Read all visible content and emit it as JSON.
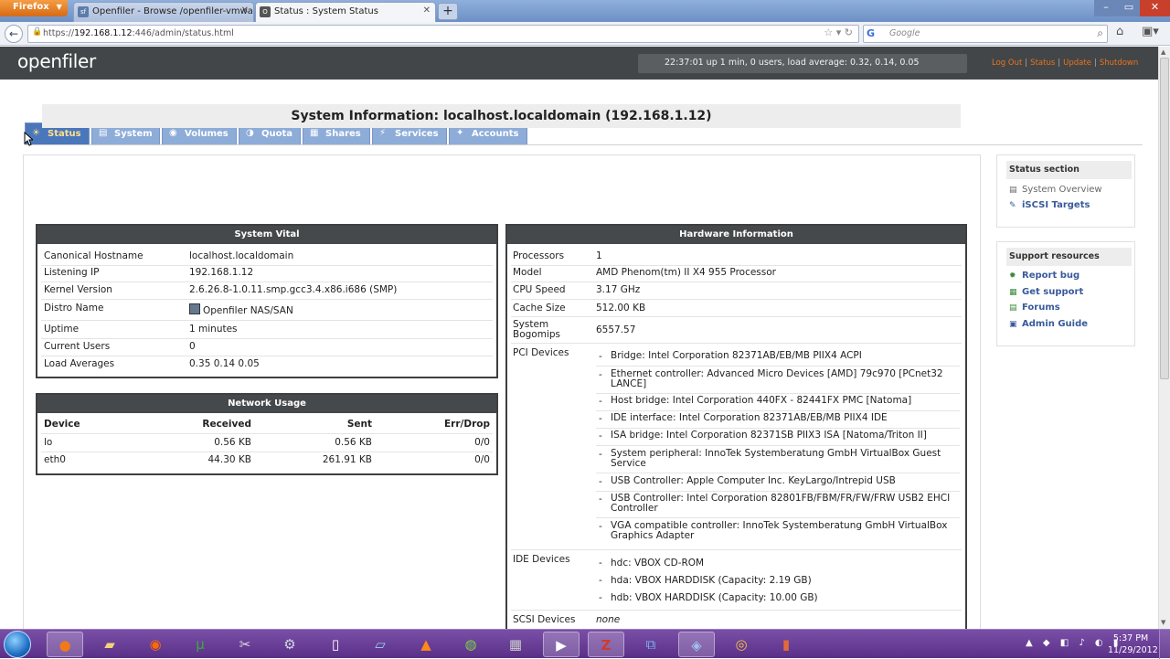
{
  "browser": {
    "app_button": "Firefox",
    "tabs": [
      {
        "title": "Openfiler - Browse /openfiler-vmwar...",
        "icon": "sf"
      },
      {
        "title": "Status : System Status",
        "icon": "O"
      }
    ],
    "url_prefix": "https://",
    "url_host": "192.168.1.12",
    "url_path": ":446/admin/status.html",
    "search_engine": "G",
    "search_placeholder": "Google"
  },
  "header": {
    "logo": "openfiler",
    "uptime": "22:37:01 up 1 min, 0 users, load average: 0.32, 0.14, 0.05",
    "links": [
      "Log Out",
      "Status",
      "Update",
      "Shutdown"
    ]
  },
  "nav_tabs": [
    {
      "label": "Status",
      "icon": "☀"
    },
    {
      "label": "System",
      "icon": "▤"
    },
    {
      "label": "Volumes",
      "icon": "◉"
    },
    {
      "label": "Quota",
      "icon": "◑"
    },
    {
      "label": "Shares",
      "icon": "▦"
    },
    {
      "label": "Services",
      "icon": "⚡"
    },
    {
      "label": "Accounts",
      "icon": "✦"
    }
  ],
  "page_title": "System Information: localhost.localdomain (192.168.1.12)",
  "system_vital": {
    "title": "System Vital",
    "rows": [
      {
        "k": "Canonical Hostname",
        "v": "localhost.localdomain"
      },
      {
        "k": "Listening IP",
        "v": "192.168.1.12"
      },
      {
        "k": "Kernel Version",
        "v": "2.6.26.8-1.0.11.smp.gcc3.4.x86.i686 (SMP)"
      },
      {
        "k": "Distro Name",
        "v": "Openfiler NAS/SAN"
      },
      {
        "k": "Uptime",
        "v": "1 minutes"
      },
      {
        "k": "Current Users",
        "v": "0"
      },
      {
        "k": "Load Averages",
        "v": "0.35 0.14 0.05"
      }
    ]
  },
  "network_usage": {
    "title": "Network Usage",
    "headers": [
      "Device",
      "Received",
      "Sent",
      "Err/Drop"
    ],
    "rows": [
      [
        "lo",
        "0.56 KB",
        "0.56 KB",
        "0/0"
      ],
      [
        "eth0",
        "44.30 KB",
        "261.91 KB",
        "0/0"
      ]
    ]
  },
  "hardware": {
    "title": "Hardware Information",
    "rows": [
      {
        "k": "Processors",
        "v": "1"
      },
      {
        "k": "Model",
        "v": "AMD Phenom(tm) II X4 955 Processor"
      },
      {
        "k": "CPU Speed",
        "v": "3.17 GHz"
      },
      {
        "k": "Cache Size",
        "v": "512.00 KB"
      },
      {
        "k1": "System",
        "k2": "Bogomips",
        "v": "6557.57"
      }
    ],
    "pci_label": "PCI Devices",
    "pci": [
      [
        "Bridge: Intel Corporation 82371AB/EB/MB PIIX4 ACPI"
      ],
      [
        "Ethernet controller: Advanced Micro Devices [AMD] 79c970 [PCnet32",
        "LANCE]"
      ],
      [
        "Host bridge: Intel Corporation 440FX - 82441FX PMC [Natoma]"
      ],
      [
        "IDE interface: Intel Corporation 82371AB/EB/MB PIIX4 IDE"
      ],
      [
        "ISA bridge: Intel Corporation 82371SB PIIX3 ISA [Natoma/Triton II]"
      ],
      [
        "System peripheral: InnoTek Systemberatung GmbH VirtualBox Guest",
        "Service"
      ],
      [
        "USB Controller: Apple Computer Inc. KeyLargo/Intrepid USB"
      ],
      [
        "USB Controller: Intel Corporation 82801FB/FBM/FR/FW/FRW USB2 EHCI",
        "Controller"
      ],
      [
        "VGA compatible controller: InnoTek Systemberatung GmbH VirtualBox",
        "Graphics Adapter"
      ]
    ],
    "ide_label": "IDE Devices",
    "ide": [
      "hdc: VBOX CD-ROM",
      "hda: VBOX HARDDISK (Capacity: 2.19 GB)",
      "hdb: VBOX HARDDISK (Capacity: 10.00 GB)"
    ],
    "scsi_label": "SCSI Devices",
    "scsi_value": "none",
    "dash": "-"
  },
  "sidebar": {
    "status_section": {
      "title": "Status section",
      "items": [
        "System Overview",
        "iSCSI Targets"
      ]
    },
    "support": {
      "title": "Support resources",
      "items": [
        "Report bug",
        "Get support",
        "Forums",
        "Admin Guide"
      ]
    }
  },
  "taskbar": {
    "time": "5:37 PM",
    "date": "11/29/2012"
  }
}
